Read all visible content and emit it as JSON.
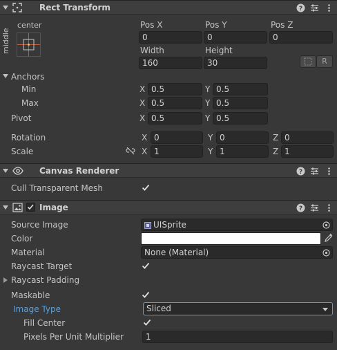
{
  "rect_transform": {
    "title": "Rect Transform",
    "anchor_h": "center",
    "anchor_v": "middle",
    "pos_x_label": "Pos X",
    "pos_y_label": "Pos Y",
    "pos_z_label": "Pos Z",
    "pos_x": "0",
    "pos_y": "0",
    "pos_z": "0",
    "width_label": "Width",
    "height_label": "Height",
    "width": "160",
    "height": "30",
    "raw_button": "R",
    "anchors_label": "Anchors",
    "min_label": "Min",
    "max_label": "Max",
    "min_x": "0.5",
    "min_y": "0.5",
    "max_x": "0.5",
    "max_y": "0.5",
    "pivot_label": "Pivot",
    "pivot_x": "0.5",
    "pivot_y": "0.5",
    "rotation_label": "Rotation",
    "rot_x": "0",
    "rot_y": "0",
    "rot_z": "0",
    "scale_label": "Scale",
    "scale_x": "1",
    "scale_y": "1",
    "scale_z": "1",
    "x": "X",
    "y": "Y",
    "z": "Z"
  },
  "canvas_renderer": {
    "title": "Canvas Renderer",
    "cull_label": "Cull Transparent Mesh",
    "cull_checked": true
  },
  "image": {
    "title": "Image",
    "source_image_label": "Source Image",
    "source_image_value": "UISprite",
    "color_label": "Color",
    "color_value": "#ffffff",
    "material_label": "Material",
    "material_value": "None (Material)",
    "raycast_target_label": "Raycast Target",
    "raycast_padding_label": "Raycast Padding",
    "maskable_label": "Maskable",
    "image_type_label": "Image Type",
    "image_type_value": "Sliced",
    "fill_center_label": "Fill Center",
    "ppu_label": "Pixels Per Unit Multiplier",
    "ppu_value": "1"
  },
  "colors": {
    "accent": "#5e9ed6",
    "background": "#383838",
    "header": "#3e3e3e",
    "field": "#2a2a2a"
  }
}
